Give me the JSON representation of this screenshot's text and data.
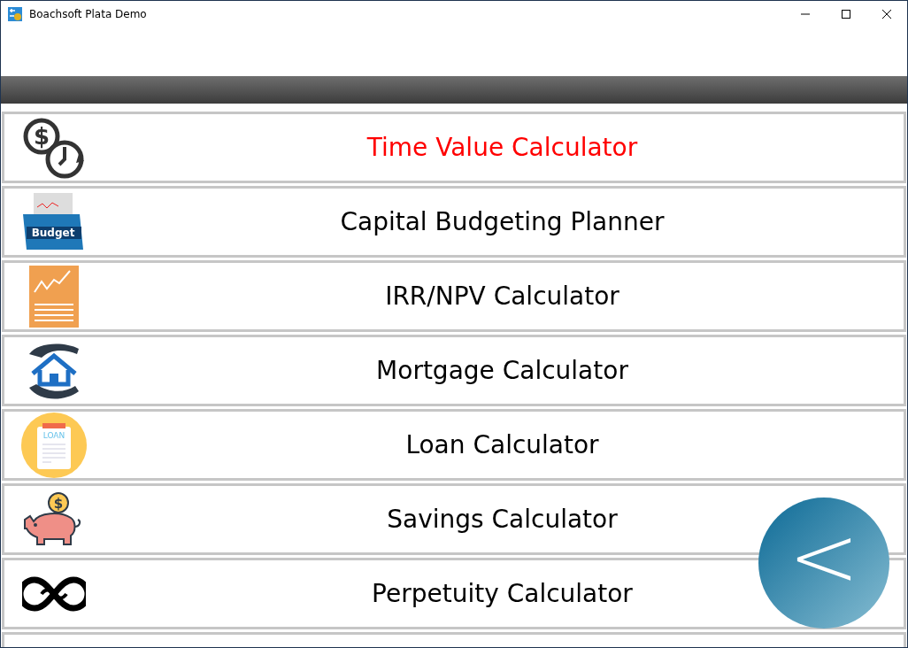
{
  "window": {
    "title": "Boachsoft Plata Demo"
  },
  "menu": [
    {
      "label": "Time Value Calculator",
      "selected": true,
      "icon_text": "$"
    },
    {
      "label": "Capital Budgeting Planner",
      "selected": false,
      "icon_text": "Budget"
    },
    {
      "label": "IRR/NPV Calculator",
      "selected": false
    },
    {
      "label": "Mortgage Calculator",
      "selected": false
    },
    {
      "label": "Loan Calculator",
      "selected": false,
      "icon_text": "LOAN"
    },
    {
      "label": "Savings Calculator",
      "selected": false,
      "icon_text": "$"
    },
    {
      "label": "Perpetuity Calculator",
      "selected": false
    }
  ],
  "back_button": {
    "label": "<"
  }
}
